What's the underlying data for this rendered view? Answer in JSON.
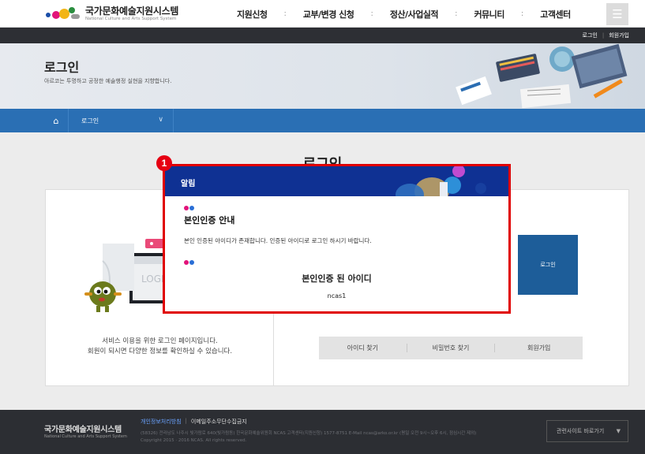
{
  "header": {
    "logo_title": "국가문화예술지원시스템",
    "logo_subtitle": "National Culture and Arts Support System",
    "nav": [
      "지원신청",
      "교부/변경 신청",
      "정산/사업실적",
      "커뮤니티",
      "고객센터"
    ],
    "menu_icon": "☰"
  },
  "topbar": {
    "login": "로그인",
    "signup": "회원가입"
  },
  "hero": {
    "title": "로그인",
    "description": "아르코는 투명하고 공정한 예술행정 실현을 지향합니다."
  },
  "breadcrumb": {
    "home_icon": "⌂",
    "current": "로그인",
    "chevron": "∨"
  },
  "main": {
    "heading": "로그인",
    "left_line1": "서비스 이용을 위한 로그인 페이지입니다.",
    "left_line2": "회원이 되시면 다양한 정보를 확인하실 수 있습니다.",
    "illustration_text": "LOGI",
    "login_button": "로그인",
    "links": [
      "아이디 찾기",
      "비밀번호 찾기",
      "회원가입"
    ]
  },
  "modal": {
    "title": "알림",
    "heading": "본인인증 안내",
    "message": "본인 인증된 아이디가 존재합니다. 인증된 아이디로 로그인 하시기 바랍니다.",
    "id_heading": "본인인증 된 아이디",
    "id_value": "ncas1"
  },
  "badge": "1",
  "footer": {
    "logo_title": "국가문화예술지원시스템",
    "logo_subtitle": "National Culture and Arts Support System",
    "privacy": "개인정보처리방침",
    "email_policy": "이메일주소무단수집금지",
    "address": "(58326) 전라남도 나주시 빛가람로 640(빛가람동) 한국문화예술위원회   NCAS 고객센터(지원신청) 1577-8751   E-Mail ncas@arko.or.kr (평일 오전 9시~오후 6시, 점심시간 제외)",
    "copyright": "Copyright 2015 · 2016 NCAS. All rights reserved.",
    "related_sites": "관련사이트 바로가기",
    "select_arrow": "▼"
  },
  "colors": {
    "modal_header": "#0f3193",
    "highlight_border": "#e00000",
    "breadcrumb_bar": "#2a6fb4",
    "login_button": "#1d5d99",
    "footer_bg": "#2c2e33"
  }
}
